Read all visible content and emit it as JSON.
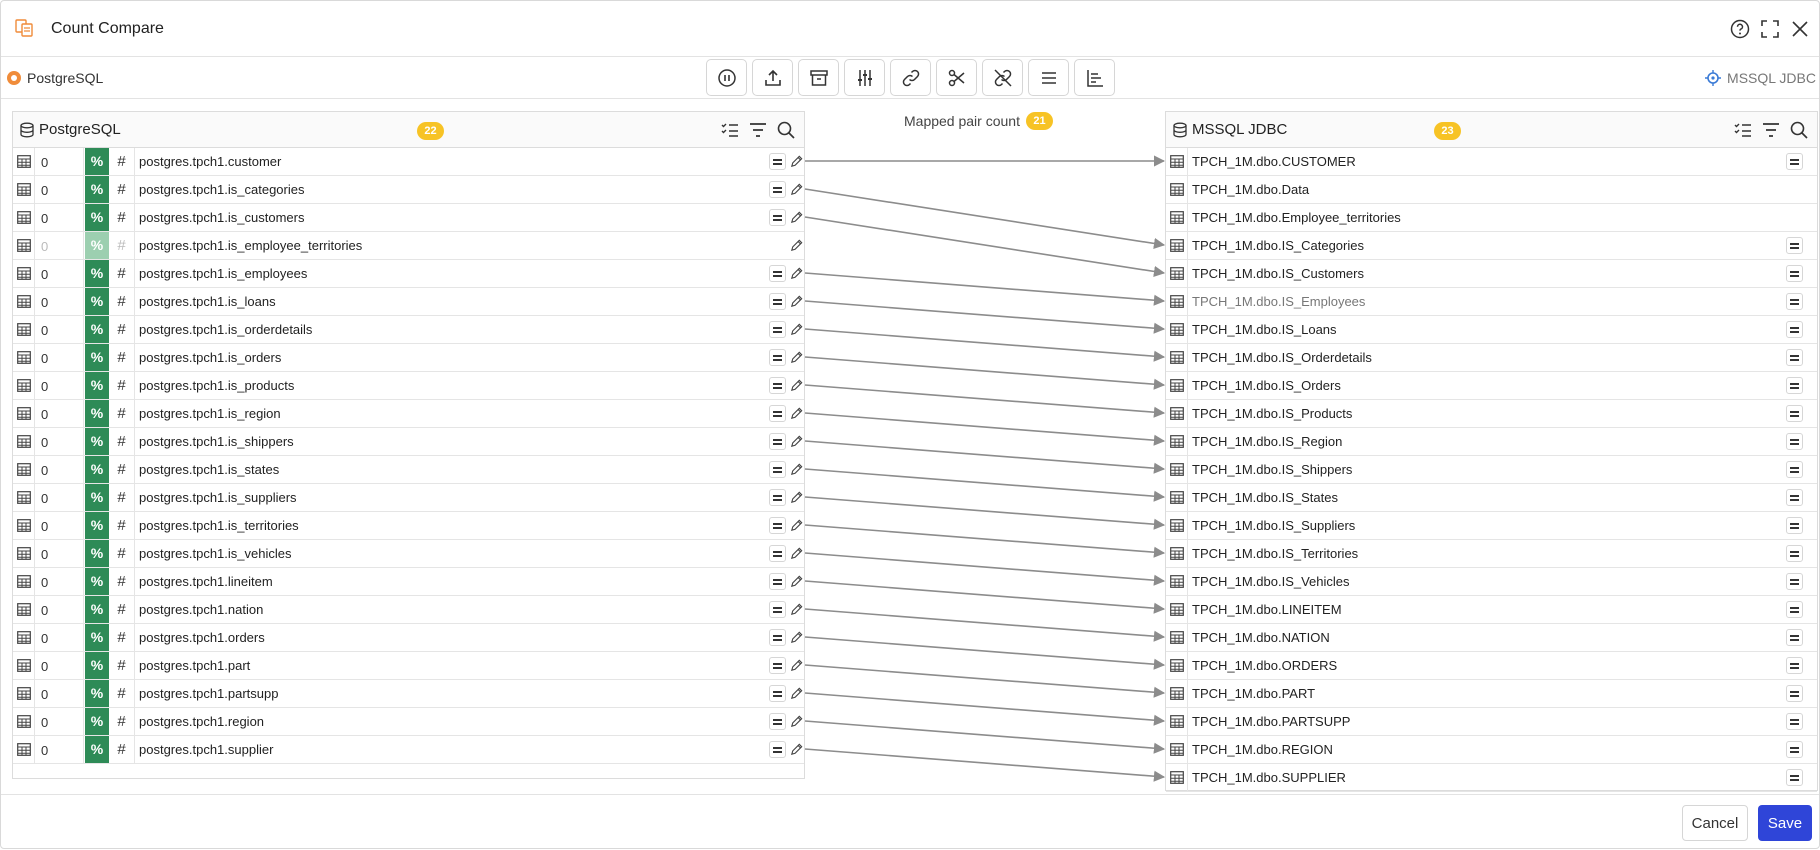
{
  "window": {
    "title": "Count Compare"
  },
  "source": {
    "left_name": "PostgreSQL",
    "right_name": "MSSQL JDBC"
  },
  "toolbar": {
    "icons": [
      "pause-icon",
      "upload-icon",
      "archive-icon",
      "sliders-icon",
      "link-icon",
      "scissors-icon",
      "unlink-icon",
      "menu-icon",
      "bar-chart-icon"
    ]
  },
  "left_panel": {
    "title": "PostgreSQL",
    "count": "22",
    "rows": [
      {
        "count": "0",
        "pct": "%",
        "hash": "#",
        "name": "postgres.tpch1.customer",
        "mapped": true
      },
      {
        "count": "0",
        "pct": "%",
        "hash": "#",
        "name": "postgres.tpch1.is_categories",
        "mapped": true
      },
      {
        "count": "0",
        "pct": "%",
        "hash": "#",
        "name": "postgres.tpch1.is_customers",
        "mapped": true
      },
      {
        "count": "0",
        "pct": "%",
        "hash": "#",
        "name": "postgres.tpch1.is_employee_territories",
        "mapped": false
      },
      {
        "count": "0",
        "pct": "%",
        "hash": "#",
        "name": "postgres.tpch1.is_employees",
        "mapped": true
      },
      {
        "count": "0",
        "pct": "%",
        "hash": "#",
        "name": "postgres.tpch1.is_loans",
        "mapped": true
      },
      {
        "count": "0",
        "pct": "%",
        "hash": "#",
        "name": "postgres.tpch1.is_orderdetails",
        "mapped": true
      },
      {
        "count": "0",
        "pct": "%",
        "hash": "#",
        "name": "postgres.tpch1.is_orders",
        "mapped": true
      },
      {
        "count": "0",
        "pct": "%",
        "hash": "#",
        "name": "postgres.tpch1.is_products",
        "mapped": true
      },
      {
        "count": "0",
        "pct": "%",
        "hash": "#",
        "name": "postgres.tpch1.is_region",
        "mapped": true
      },
      {
        "count": "0",
        "pct": "%",
        "hash": "#",
        "name": "postgres.tpch1.is_shippers",
        "mapped": true
      },
      {
        "count": "0",
        "pct": "%",
        "hash": "#",
        "name": "postgres.tpch1.is_states",
        "mapped": true
      },
      {
        "count": "0",
        "pct": "%",
        "hash": "#",
        "name": "postgres.tpch1.is_suppliers",
        "mapped": true
      },
      {
        "count": "0",
        "pct": "%",
        "hash": "#",
        "name": "postgres.tpch1.is_territories",
        "mapped": true
      },
      {
        "count": "0",
        "pct": "%",
        "hash": "#",
        "name": "postgres.tpch1.is_vehicles",
        "mapped": true
      },
      {
        "count": "0",
        "pct": "%",
        "hash": "#",
        "name": "postgres.tpch1.lineitem",
        "mapped": true
      },
      {
        "count": "0",
        "pct": "%",
        "hash": "#",
        "name": "postgres.tpch1.nation",
        "mapped": true
      },
      {
        "count": "0",
        "pct": "%",
        "hash": "#",
        "name": "postgres.tpch1.orders",
        "mapped": true
      },
      {
        "count": "0",
        "pct": "%",
        "hash": "#",
        "name": "postgres.tpch1.part",
        "mapped": true
      },
      {
        "count": "0",
        "pct": "%",
        "hash": "#",
        "name": "postgres.tpch1.partsupp",
        "mapped": true
      },
      {
        "count": "0",
        "pct": "%",
        "hash": "#",
        "name": "postgres.tpch1.region",
        "mapped": true
      },
      {
        "count": "0",
        "pct": "%",
        "hash": "#",
        "name": "postgres.tpch1.supplier",
        "mapped": true
      }
    ]
  },
  "mapped": {
    "label": "Mapped pair count",
    "count": "21"
  },
  "right_panel": {
    "title": "MSSQL JDBC",
    "count": "23",
    "rows": [
      {
        "name": "TPCH_1M.dbo.CUSTOMER",
        "mapped": true
      },
      {
        "name": "TPCH_1M.dbo.Data",
        "mapped": false
      },
      {
        "name": "TPCH_1M.dbo.Employee_territories",
        "mapped": false
      },
      {
        "name": "TPCH_1M.dbo.IS_Categories",
        "mapped": true
      },
      {
        "name": "TPCH_1M.dbo.IS_Customers",
        "mapped": true
      },
      {
        "name": "TPCH_1M.dbo.IS_Employees",
        "mapped": true,
        "dim": true
      },
      {
        "name": "TPCH_1M.dbo.IS_Loans",
        "mapped": true
      },
      {
        "name": "TPCH_1M.dbo.IS_Orderdetails",
        "mapped": true
      },
      {
        "name": "TPCH_1M.dbo.IS_Orders",
        "mapped": true
      },
      {
        "name": "TPCH_1M.dbo.IS_Products",
        "mapped": true
      },
      {
        "name": "TPCH_1M.dbo.IS_Region",
        "mapped": true
      },
      {
        "name": "TPCH_1M.dbo.IS_Shippers",
        "mapped": true
      },
      {
        "name": "TPCH_1M.dbo.IS_States",
        "mapped": true
      },
      {
        "name": "TPCH_1M.dbo.IS_Suppliers",
        "mapped": true
      },
      {
        "name": "TPCH_1M.dbo.IS_Territories",
        "mapped": true
      },
      {
        "name": "TPCH_1M.dbo.IS_Vehicles",
        "mapped": true
      },
      {
        "name": "TPCH_1M.dbo.LINEITEM",
        "mapped": true
      },
      {
        "name": "TPCH_1M.dbo.NATION",
        "mapped": true
      },
      {
        "name": "TPCH_1M.dbo.ORDERS",
        "mapped": true
      },
      {
        "name": "TPCH_1M.dbo.PART",
        "mapped": true
      },
      {
        "name": "TPCH_1M.dbo.PARTSUPP",
        "mapped": true
      },
      {
        "name": "TPCH_1M.dbo.REGION",
        "mapped": true
      },
      {
        "name": "TPCH_1M.dbo.SUPPLIER",
        "mapped": true
      }
    ]
  },
  "mappings": [
    [
      0,
      0
    ],
    [
      1,
      3
    ],
    [
      2,
      4
    ],
    [
      4,
      5
    ],
    [
      5,
      6
    ],
    [
      6,
      7
    ],
    [
      7,
      8
    ],
    [
      8,
      9
    ],
    [
      9,
      10
    ],
    [
      10,
      11
    ],
    [
      11,
      12
    ],
    [
      12,
      13
    ],
    [
      13,
      14
    ],
    [
      14,
      15
    ],
    [
      15,
      16
    ],
    [
      16,
      17
    ],
    [
      17,
      18
    ],
    [
      18,
      19
    ],
    [
      19,
      20
    ],
    [
      20,
      21
    ],
    [
      21,
      22
    ]
  ],
  "footer": {
    "cancel_label": "Cancel",
    "save_label": "Save"
  },
  "colors": {
    "accent": "#2f45d8",
    "pct": "#2e8b57",
    "badge": "#f7c325",
    "link": "#8c8c8c"
  }
}
